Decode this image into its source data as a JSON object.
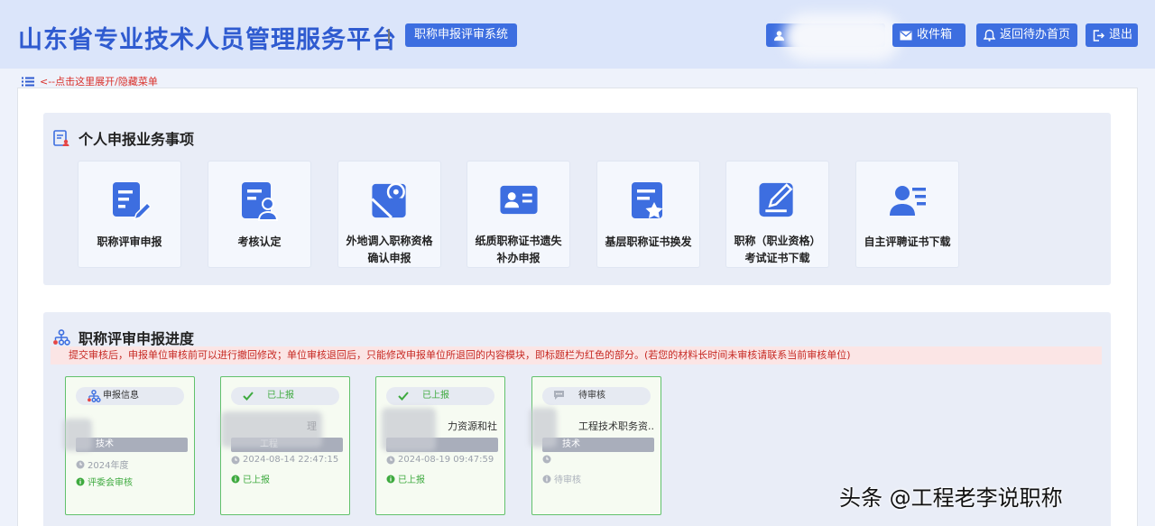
{
  "header": {
    "title": "山东省专业技术人员管理服务平台",
    "system_label": "职称申报评审系统",
    "inbox_label": "收件箱",
    "home_label": "返回待办首页",
    "logout_label": "退出"
  },
  "menu_toggle": {
    "label": "<--点击这里展开/隐藏菜单"
  },
  "business": {
    "title": "个人申报业务事项",
    "tiles": [
      {
        "label": "职称评审申报",
        "icon": "form-edit-icon"
      },
      {
        "label": "考核认定",
        "icon": "user-document-icon"
      },
      {
        "label": "外地调入职称资格确认申报",
        "icon": "map-pin-icon"
      },
      {
        "label": "纸质职称证书遗失补办申报",
        "icon": "id-card-icon"
      },
      {
        "label": "基层职称证书换发",
        "icon": "certificate-star-icon"
      },
      {
        "label": "职称（职业资格）考试证书下载",
        "icon": "pen-edit-icon"
      },
      {
        "label": "自主评聘证书下载",
        "icon": "user-list-icon"
      }
    ]
  },
  "progress": {
    "title": "职称评审申报进度",
    "notice": "提交审核后，申报单位审核前可以进行撤回修改；单位审核退回后，只能修改申报单位所退回的内容模块，即标题栏为红色的部分。(若您的材料长时间未审核请联系当前审核单位)",
    "cards": [
      {
        "pill": "申报信息",
        "pill_icon": "org-chart-icon",
        "title": "",
        "band": "技术",
        "date": "2024年度",
        "status": "评委会审核"
      },
      {
        "pill": "已上报",
        "pill_icon": "check-icon",
        "title": "理",
        "band": "工程",
        "date": "2024-08-14 22:47:15",
        "status": "已上报"
      },
      {
        "pill": "已上报",
        "pill_icon": "check-icon",
        "title": "力资源和社...",
        "band": "",
        "date": "2024-08-19 09:47:59",
        "status": "已上报"
      },
      {
        "pill": "待审核",
        "pill_icon": "comment-icon",
        "title": "工程技术职务资...",
        "band": "技术",
        "date": "",
        "status": "待审核"
      }
    ]
  },
  "watermark": "头条 @工程老李说职称",
  "colors": {
    "primary": "#3d6ee0",
    "header_bg": "#dbe5fa",
    "success": "#3eaa3f",
    "notice_red": "#c72a24"
  }
}
